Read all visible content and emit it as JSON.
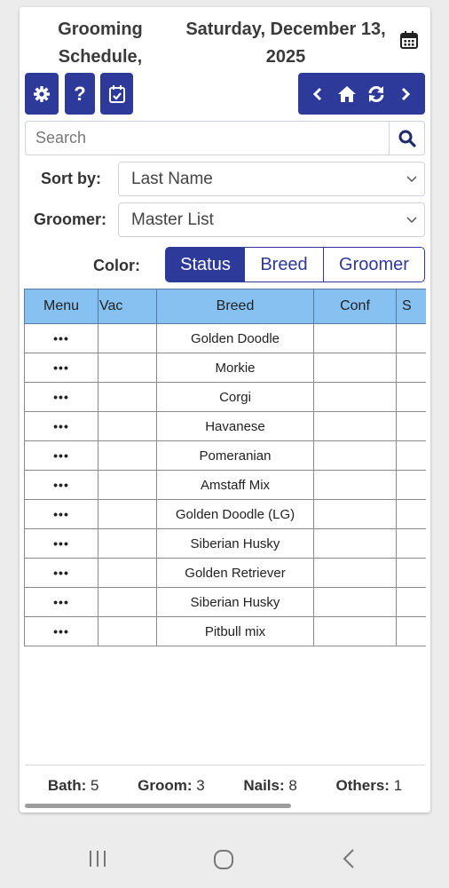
{
  "header": {
    "title_line1": "Grooming",
    "title_line2": "Schedule,",
    "date_line1": "Saturday, December 13,",
    "date_line2": "2025"
  },
  "toolbar": {
    "help_label": "?"
  },
  "search": {
    "placeholder": "Search",
    "value": ""
  },
  "filters": {
    "sort_label": "Sort by:",
    "sort_value": "Last Name",
    "groomer_label": "Groomer:",
    "groomer_value": "Master List",
    "color_label": "Color:",
    "color_options": [
      "Status",
      "Breed",
      "Groomer"
    ],
    "color_selected": "Status"
  },
  "table": {
    "columns": [
      "Menu",
      "Vac",
      "Breed",
      "Conf",
      "S"
    ],
    "rows": [
      {
        "menu": "•••",
        "vac": "",
        "breed": "Golden Doodle",
        "conf": ""
      },
      {
        "menu": "•••",
        "vac": "",
        "breed": "Morkie",
        "conf": ""
      },
      {
        "menu": "•••",
        "vac": "",
        "breed": "Corgi",
        "conf": ""
      },
      {
        "menu": "•••",
        "vac": "",
        "breed": "Havanese",
        "conf": ""
      },
      {
        "menu": "•••",
        "vac": "",
        "breed": "Pomeranian",
        "conf": ""
      },
      {
        "menu": "•••",
        "vac": "",
        "breed": "Amstaff Mix",
        "conf": ""
      },
      {
        "menu": "•••",
        "vac": "",
        "breed": "Golden Doodle (LG)",
        "conf": ""
      },
      {
        "menu": "•••",
        "vac": "",
        "breed": "Siberian Husky",
        "conf": ""
      },
      {
        "menu": "•••",
        "vac": "",
        "breed": "Golden Retriever",
        "conf": ""
      },
      {
        "menu": "•••",
        "vac": "",
        "breed": "Siberian Husky",
        "conf": ""
      },
      {
        "menu": "•••",
        "vac": "",
        "breed": "Pitbull mix",
        "conf": ""
      }
    ]
  },
  "summary": {
    "bath_label": "Bath:",
    "bath_value": "5",
    "groom_label": "Groom:",
    "groom_value": "3",
    "nails_label": "Nails:",
    "nails_value": "8",
    "others_label": "Others:",
    "others_value": "1"
  },
  "colors": {
    "primary": "#2e3a99",
    "table_header": "#86c1f1"
  },
  "icons": [
    "calendar-icon",
    "gear-icon",
    "calendar-check-icon",
    "chevron-left-icon",
    "home-icon",
    "refresh-icon",
    "chevron-right-icon",
    "search-icon",
    "chevron-down-icon",
    "recent-apps-icon",
    "home-circle-icon",
    "back-icon"
  ]
}
